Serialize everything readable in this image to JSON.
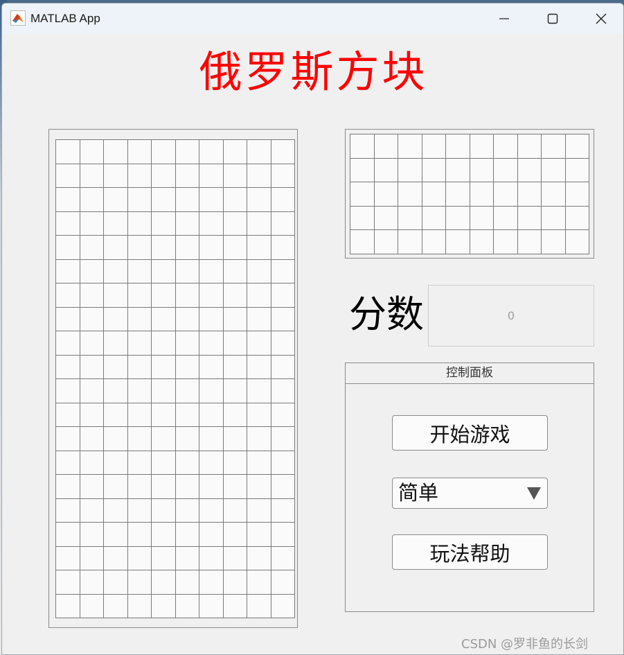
{
  "window": {
    "title": "MATLAB App",
    "icons": {
      "app": "matlab-app-icon",
      "minimize": "minimize-icon",
      "maximize": "maximize-icon",
      "close": "close-icon"
    }
  },
  "game": {
    "title": "俄罗斯方块",
    "title_color": "#ff0000",
    "board": {
      "columns": 10,
      "rows": 20
    },
    "preview": {
      "columns": 10,
      "rows": 5
    },
    "score_label": "分数",
    "score_value": "0"
  },
  "control_panel": {
    "title": "控制面板",
    "start_button": "开始游戏",
    "difficulty_selected": "简单",
    "help_button": "玩法帮助"
  },
  "watermark": "CSDN @罗非鱼的长剑"
}
